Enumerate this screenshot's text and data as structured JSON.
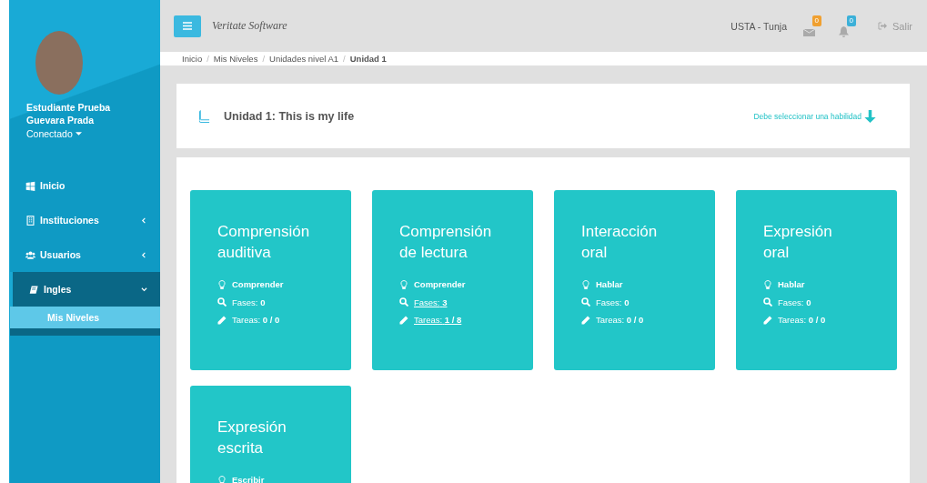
{
  "sidebar": {
    "user": {
      "name": "Estudiante Prueba Guevara Prada",
      "status": "Conectado"
    },
    "items": [
      {
        "label": "Inicio",
        "kind": "link",
        "selected": false
      },
      {
        "label": "Instituciones",
        "kind": "menu",
        "expanded": false,
        "selected": false
      },
      {
        "label": "Usuarios",
        "kind": "menu",
        "expanded": false,
        "selected": false
      },
      {
        "label": "Ingles",
        "kind": "menu",
        "expanded": true,
        "selected": true,
        "children": [
          {
            "label": "Mis Niveles",
            "selected": true
          }
        ]
      }
    ]
  },
  "topbar": {
    "brand": "Veritate Software",
    "institution": "USTA - Tunja",
    "notifications": [
      {
        "count": "0",
        "color": "#f0a030"
      },
      {
        "count": "0",
        "color": "#3bb0d8"
      }
    ],
    "logout": "Salir"
  },
  "breadcrumb_separator": "/",
  "breadcrumb": [
    {
      "label": "Inicio",
      "current": false
    },
    {
      "label": "Mis Niveles",
      "current": false
    },
    {
      "label": "Unidades nivel A1",
      "current": false
    },
    {
      "label": "Unidad 1",
      "current": true
    }
  ],
  "unit": {
    "title": "Unidad 1: This is my life",
    "hint": "Debe seleccionar una habilidad"
  },
  "skills": [
    {
      "title": "Comprensión auditiva",
      "ability": "Comprender",
      "phases_label": "Fases:",
      "phases": "0",
      "tasks_label": "Tareas:",
      "tasks": "0 / 0",
      "linked": false
    },
    {
      "title": "Comprensión de lectura",
      "ability": "Comprender",
      "phases_label": "Fases:",
      "phases": "3",
      "tasks_label": "Tareas:",
      "tasks": "1 / 8",
      "linked": true
    },
    {
      "title": "Interacción oral",
      "ability": "Hablar",
      "phases_label": "Fases:",
      "phases": "0",
      "tasks_label": "Tareas:",
      "tasks": "0 / 0",
      "linked": false
    },
    {
      "title": "Expresión oral",
      "ability": "Hablar",
      "phases_label": "Fases:",
      "phases": "0",
      "tasks_label": "Tareas:",
      "tasks": "0 / 0",
      "linked": false
    },
    {
      "title": "Expresión escrita",
      "ability": "Escribir"
    }
  ]
}
